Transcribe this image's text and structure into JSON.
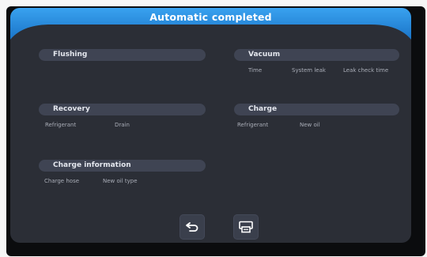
{
  "header": {
    "title": "Automatic completed",
    "accent_color": "#1f8ae0"
  },
  "sections": {
    "flushing": {
      "label": "Flushing",
      "fields": []
    },
    "vacuum": {
      "label": "Vacuum",
      "fields": [
        "Time",
        "System leak",
        "Leak check time"
      ]
    },
    "recovery": {
      "label": "Recovery",
      "fields": [
        "Refrigerant",
        "Drain"
      ]
    },
    "charge": {
      "label": "Charge",
      "fields": [
        "Refrigerant",
        "New oil"
      ]
    },
    "charge_information": {
      "label": "Charge information",
      "fields": [
        "Charge hose",
        "New oil type"
      ]
    }
  },
  "buttons": {
    "back": {
      "icon": "return-arrow-icon"
    },
    "print": {
      "icon": "printer-icon"
    }
  }
}
